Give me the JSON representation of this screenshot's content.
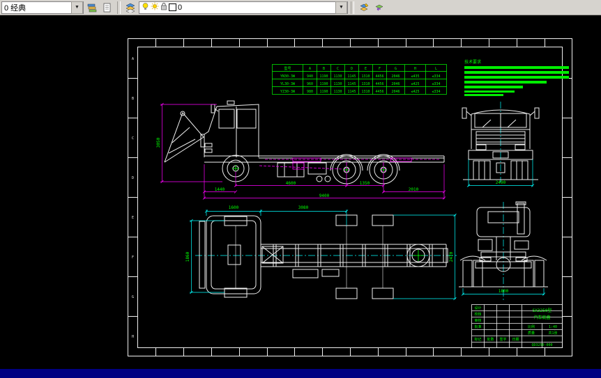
{
  "toolbar": {
    "workspace_value": "0 经典",
    "layer_value": "0"
  },
  "sheet": {
    "zones": [
      "A",
      "B",
      "C",
      "D",
      "E",
      "F",
      "G",
      "H"
    ]
  },
  "table": {
    "headers": [
      "型号",
      "A",
      "B",
      "C",
      "D",
      "E",
      "F",
      "G",
      "H",
      "L"
    ],
    "rows": [
      [
        "YN30-3W",
        "940",
        "1190",
        "1130",
        "1145",
        "1310",
        "4456",
        "2046",
        "≤435",
        "≤334"
      ],
      [
        "YL30-3W",
        "960",
        "1190",
        "1130",
        "1145",
        "1310",
        "4456",
        "2046",
        "≤425",
        "≤334"
      ],
      [
        "YZ30-3W",
        "980",
        "1190",
        "1130",
        "1145",
        "1310",
        "4456",
        "2046",
        "≤425",
        "≤334"
      ]
    ]
  },
  "notes": {
    "title": "技术要求"
  },
  "dims": {
    "cab_height": "3050",
    "wheelbase": "4600",
    "tandem": "1350",
    "front_overhang": "1440",
    "rear_overhang": "2010",
    "overall_length": "9400",
    "cab_length": "1600",
    "mid_span": "3080",
    "track": "1860",
    "overall_width": "2470",
    "front_width": "2490",
    "rear_track": "1800"
  },
  "titleblock": {
    "f1": "设计",
    "f2": "校核",
    "f3": "审核",
    "f4": "批准",
    "b1": "标记",
    "b2": "处数",
    "b3": "签字",
    "b4": "日期",
    "title1": "SX3250型",
    "title2": "汽车底盘",
    "scale_label": "比例",
    "scale": "1:40",
    "mass_label": "质量",
    "sheets": "共1张",
    "drawing_no": "QD3250-000"
  }
}
